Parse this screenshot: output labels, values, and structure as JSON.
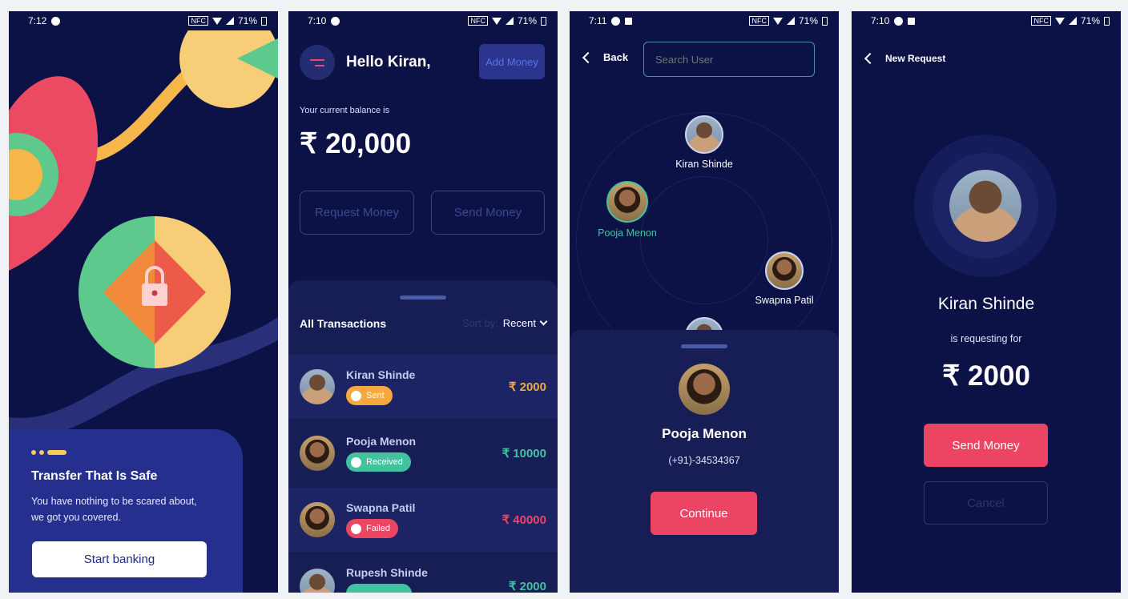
{
  "screen1": {
    "time": "7:12",
    "battery": "71%",
    "title": "Transfer That Is Safe",
    "desc1": "You have nothing to be scared about,",
    "desc2": "we got you covered.",
    "cta": "Start banking"
  },
  "screen2": {
    "time": "7:10",
    "battery": "71%",
    "greeting": "Hello Kiran,",
    "add_money": "Add Money",
    "balance_label": "Your current balance is",
    "balance": "₹ 20,000",
    "request_money": "Request Money",
    "send_money": "Send Money",
    "section_title": "All Transactions",
    "sort_label": "Sort by:",
    "sort_value": "Recent",
    "transactions": [
      {
        "name": "Kiran Shinde",
        "status": "Sent",
        "amount": "₹ 2000"
      },
      {
        "name": "Pooja Menon",
        "status": "Received",
        "amount": "₹ 10000"
      },
      {
        "name": "Swapna Patil",
        "status": "Failed",
        "amount": "₹ 40000"
      },
      {
        "name": "Rupesh Shinde",
        "status": "",
        "amount": "₹ 2000"
      }
    ],
    "colors": {
      "sent": "#f5a93f",
      "received": "#43c2a0",
      "failed": "#ec4563"
    }
  },
  "screen3": {
    "time": "7:11",
    "battery": "71%",
    "back": "Back",
    "search_placeholder": "Search User",
    "people": [
      "Kiran Shinde",
      "Pooja Menon",
      "Swapna Patil"
    ],
    "selected_name": "Pooja Menon",
    "selected_phone": "(+91)-34534367",
    "continue": "Continue"
  },
  "screen4": {
    "time": "7:10",
    "battery": "71%",
    "title": "New Request",
    "name": "Kiran Shinde",
    "subtitle": "is requesting for",
    "amount": "₹ 2000",
    "send": "Send Money",
    "cancel": "Cancel"
  }
}
